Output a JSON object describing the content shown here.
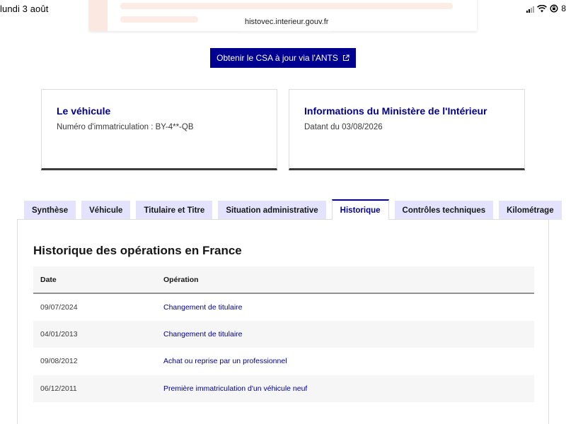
{
  "status_bar": {
    "time": "lundi 3 août",
    "battery": "8"
  },
  "browser": {
    "url": "histovec.interieur.gouv.fr"
  },
  "csa_button": {
    "label": "Obtenir le CSA à jour via l'ANTS",
    "icon": "external-link-icon"
  },
  "vehicle_card": {
    "title": "Le véhicule",
    "subtitle": "Numéro d'immatriculation : BY-4**-QB"
  },
  "ministry_card": {
    "title": "Informations du Ministère de l'Intérieur",
    "subtitle": "Datant du 03/08/2026"
  },
  "tabs": [
    {
      "label": "Synthèse",
      "active": false
    },
    {
      "label": "Véhicule",
      "active": false
    },
    {
      "label": "Titulaire et Titre",
      "active": false
    },
    {
      "label": "Situation administrative",
      "active": false
    },
    {
      "label": "Historique",
      "active": true
    },
    {
      "label": "Contrôles techniques",
      "active": false
    },
    {
      "label": "Kilométrage",
      "active": false
    }
  ],
  "history": {
    "title": "Historique des opérations en France",
    "columns": [
      "Date",
      "Opération"
    ],
    "rows": [
      {
        "date": "09/07/2024",
        "operation": "Changement de titulaire"
      },
      {
        "date": "04/01/2013",
        "operation": "Changement de titulaire"
      },
      {
        "date": "09/08/2012",
        "operation": "Achat ou reprise par un professionnel"
      },
      {
        "date": "06/12/2011",
        "operation": "Première immatriculation d'un véhicule neuf"
      }
    ]
  },
  "colors": {
    "primary": "#000091",
    "tab_bg": "#e3e3fd",
    "row_alt": "#f6f6f6"
  }
}
